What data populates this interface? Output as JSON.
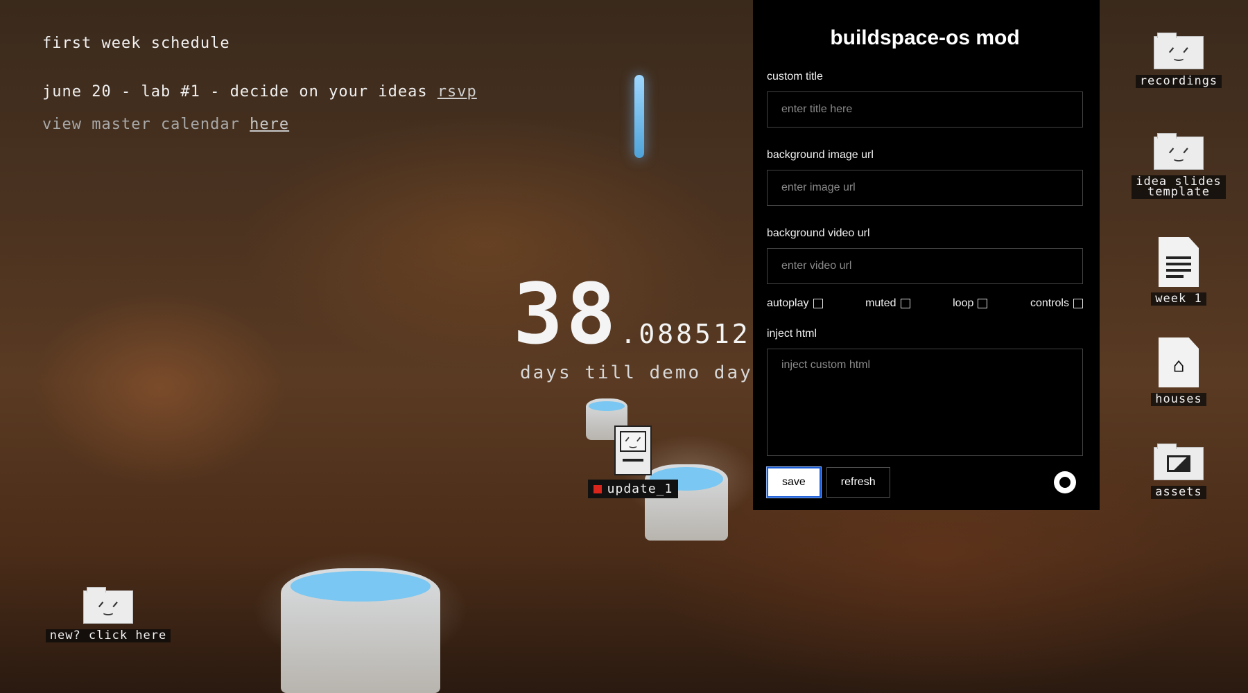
{
  "schedule": {
    "title": "first week schedule",
    "event_text": "june 20 - lab #1 - decide on your ideas",
    "event_link": "rsvp",
    "calendar_text": "view master calendar",
    "calendar_link": "here"
  },
  "countdown": {
    "days": "38",
    "fraction": ".088512",
    "caption": "days till demo day"
  },
  "desktop": {
    "update_label": "update_1",
    "new_label": "new? click here",
    "icons": [
      {
        "label": "recordings",
        "icon": "folder-icon"
      },
      {
        "label_line1": "idea slides",
        "label_line2": "template",
        "icon": "folder-icon"
      },
      {
        "label": "week 1",
        "icon": "document-icon"
      },
      {
        "label": "houses",
        "icon": "house-document-icon"
      },
      {
        "label": "assets",
        "icon": "image-folder-icon"
      }
    ]
  },
  "panel": {
    "title": "buildspace-os mod",
    "custom_title_label": "custom title",
    "custom_title_placeholder": "enter title here",
    "bg_image_label": "background image url",
    "bg_image_placeholder": "enter image url",
    "bg_video_label": "background video url",
    "bg_video_placeholder": "enter video url",
    "checkboxes": [
      {
        "label": "autoplay",
        "checked": false
      },
      {
        "label": "muted",
        "checked": false
      },
      {
        "label": "loop",
        "checked": false
      },
      {
        "label": "controls",
        "checked": false
      }
    ],
    "inject_label": "inject html",
    "inject_placeholder": "inject custom html",
    "save_label": "save",
    "refresh_label": "refresh",
    "github_icon": "github-icon"
  },
  "colors": {
    "panel_bg": "#000000",
    "accent_focus": "#1a5cd7",
    "status_dot": "#d9251c"
  }
}
